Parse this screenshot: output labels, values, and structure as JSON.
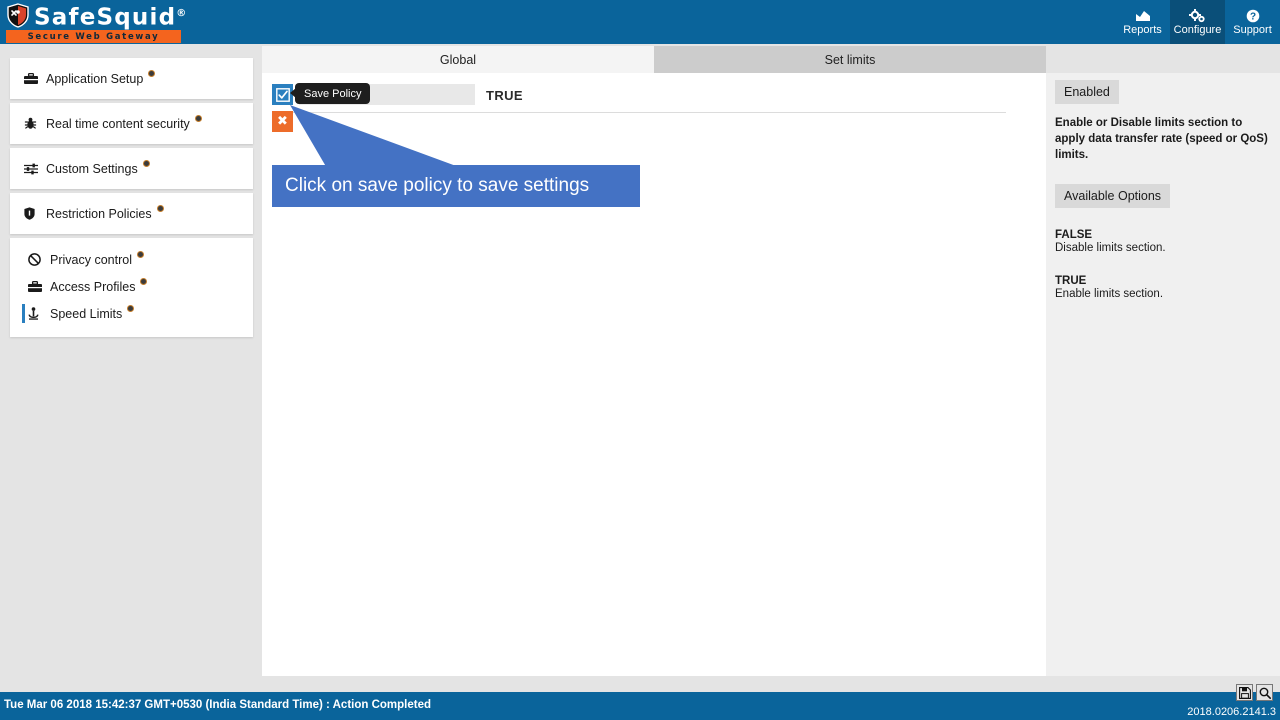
{
  "brand": {
    "name": "SafeSquid",
    "registered": "®",
    "tagline": "Secure Web Gateway",
    "logo_icon": "shield-logo-icon"
  },
  "header": {
    "nav": [
      {
        "label": "Reports",
        "icon": "chart-icon",
        "active": false
      },
      {
        "label": "Configure",
        "icon": "gears-icon",
        "active": true
      },
      {
        "label": "Support",
        "icon": "question-circle-icon",
        "active": false
      }
    ]
  },
  "tabs": [
    {
      "label": "Global",
      "active": false
    },
    {
      "label": "Set limits",
      "active": true
    }
  ],
  "sidebar": {
    "groups": [
      {
        "items": [
          {
            "label": "Application Setup",
            "icon": "briefcase-icon",
            "active": false
          }
        ]
      },
      {
        "items": [
          {
            "label": "Real time content security",
            "icon": "bug-icon",
            "active": false
          }
        ]
      },
      {
        "items": [
          {
            "label": "Custom Settings",
            "icon": "sliders-icon",
            "active": false
          }
        ]
      },
      {
        "items": [
          {
            "label": "Restriction Policies",
            "icon": "shield-icon",
            "active": false
          }
        ]
      },
      {
        "items": [
          {
            "label": "Privacy control",
            "icon": "ban-icon",
            "active": false
          },
          {
            "label": "Access Profiles",
            "icon": "briefcase-icon",
            "active": false
          },
          {
            "label": "Speed Limits",
            "icon": "speed-icon",
            "active": true
          }
        ]
      }
    ]
  },
  "main": {
    "save_button_icon": "checkbox-checked-icon",
    "save_tooltip": "Save Policy",
    "delete_button_icon": "close-x-icon",
    "delete_button_label": "✖",
    "field_value": "TRUE",
    "callout": "Click on save policy to save settings"
  },
  "help": {
    "section_title": "Enabled",
    "description": "Enable or Disable limits section to apply data transfer rate (speed or QoS) limits.",
    "options_title": "Available Options",
    "options": [
      {
        "name": "FALSE",
        "desc": "Disable limits section."
      },
      {
        "name": "TRUE",
        "desc": "Enable limits section."
      }
    ]
  },
  "footer": {
    "status": "Tue Mar 06 2018 15:42:37 GMT+0530 (India Standard Time) : Action Completed",
    "version": "2018.0206.2141.3",
    "tools": [
      {
        "icon": "save-floppy-icon"
      },
      {
        "icon": "search-magnifier-icon"
      }
    ]
  },
  "colors": {
    "brand_blue": "#0a649b",
    "accent_orange": "#ed6c2a",
    "callout_blue": "#4472c4",
    "active_blue": "#2a7fbf"
  }
}
